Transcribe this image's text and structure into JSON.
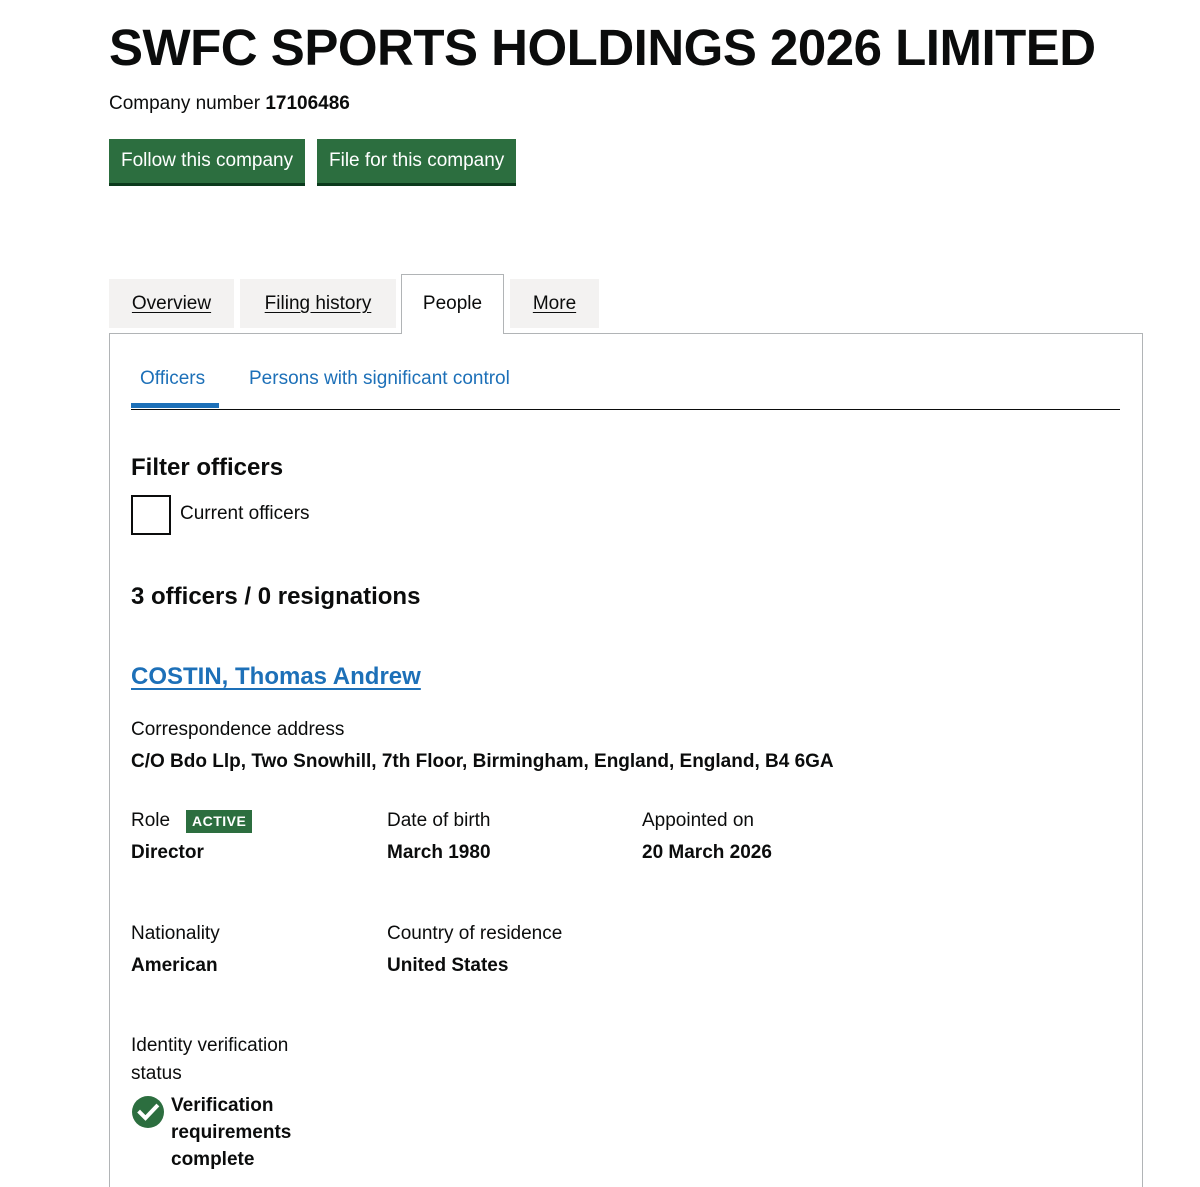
{
  "company": {
    "name": "SWFC SPORTS HOLDINGS 2026 LIMITED",
    "number_label": "Company number",
    "number": "17106486"
  },
  "actions": {
    "follow": "Follow this company",
    "file": "File for this company"
  },
  "tabs": [
    {
      "label": "Overview"
    },
    {
      "label": "Filing history"
    },
    {
      "label": "People",
      "selected": true
    },
    {
      "label": "More"
    }
  ],
  "subtabs": [
    {
      "label": "Officers",
      "selected": true
    },
    {
      "label": "Persons with significant control"
    }
  ],
  "filter": {
    "heading": "Filter officers",
    "checkbox_label": "Current officers"
  },
  "officers_count": "3 officers / 0 resignations",
  "officer": {
    "name": "COSTIN, Thomas Andrew",
    "address_label": "Correspondence address",
    "address": "C/O Bdo Llp, Two Snowhill, 7th Floor, Birmingham, England, England, B4 6GA",
    "role_label": "Role",
    "role_status": "ACTIVE",
    "role": "Director",
    "dob_label": "Date of birth",
    "dob": "March 1980",
    "appointed_label": "Appointed on",
    "appointed": "20 March 2026",
    "nationality_label": "Nationality",
    "nationality": "American",
    "residence_label": "Country of residence",
    "residence": "United States",
    "idv_label": "Identity verification status",
    "idv_status": "Verification requirements complete"
  },
  "colors": {
    "button_green": "#2c6e3f",
    "link_blue": "#1d70b8",
    "text": "#0b0c0c",
    "tab_grey": "#f3f2f1"
  },
  "icons": {
    "verification": "check-circle-icon"
  }
}
